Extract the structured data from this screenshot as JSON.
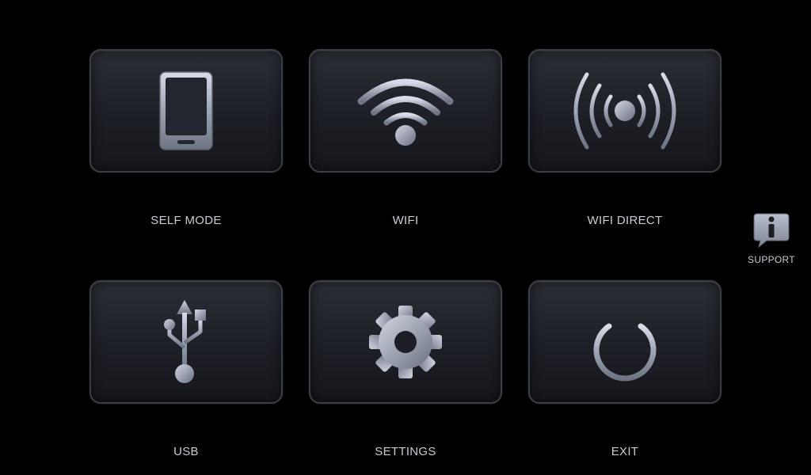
{
  "menu": {
    "self_mode": {
      "label": "SELF MODE",
      "icon": "smartphone-icon"
    },
    "wifi": {
      "label": "WIFI",
      "icon": "wifi-icon"
    },
    "wifi_direct": {
      "label": "WIFI DIRECT",
      "icon": "broadcast-icon"
    },
    "usb": {
      "label": "USB",
      "icon": "usb-icon"
    },
    "settings": {
      "label": "SETTINGS",
      "icon": "gear-icon"
    },
    "exit": {
      "label": "EXIT",
      "icon": "power-icon"
    }
  },
  "support": {
    "label": "SUPPORT",
    "icon": "info-bubble-icon"
  },
  "colors": {
    "background": "#000000",
    "tile": "#1f2128",
    "tile_border": "#3a3d44",
    "icon_metal": "#a9aebb",
    "label": "#c9ccd4"
  }
}
